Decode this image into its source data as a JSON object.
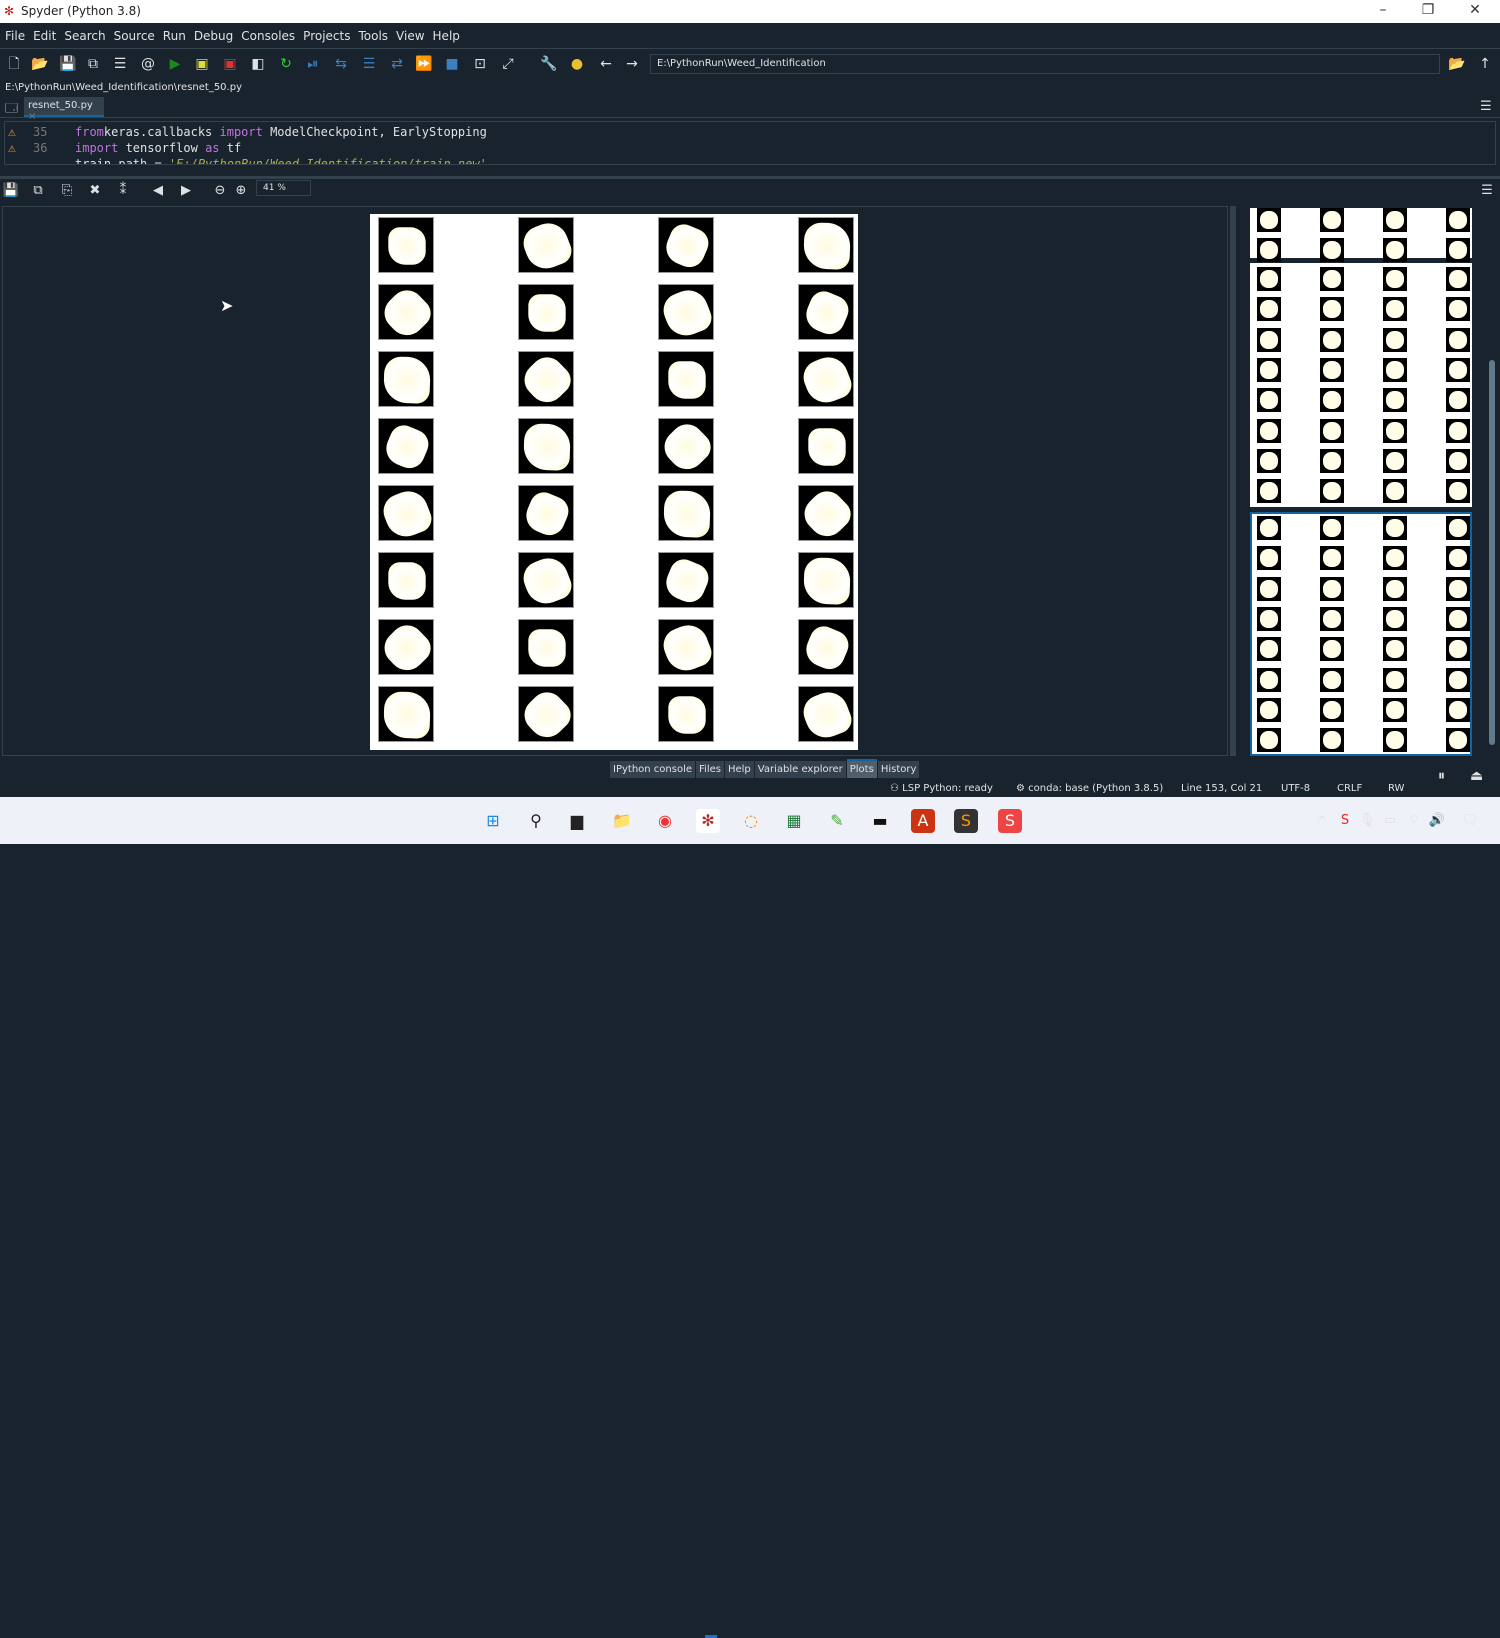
{
  "window": {
    "title": "Spyder (Python 3.8)"
  },
  "menu": [
    "File",
    "Edit",
    "Search",
    "Source",
    "Run",
    "Debug",
    "Consoles",
    "Projects",
    "Tools",
    "View",
    "Help"
  ],
  "toolbar": {
    "working_dir": "E:\\PythonRun\\Weed_Identification"
  },
  "editor": {
    "file_path": "E:\\PythonRun\\Weed_Identification\\resnet_50.py",
    "tab": "resnet_50.py",
    "lines": [
      {
        "no": "35",
        "parts": [
          [
            "kw",
            "from"
          ],
          [
            "",
            "keras.callbacks "
          ],
          [
            "kw",
            "import"
          ],
          [
            "",
            " ModelCheckpoint, EarlyStopping"
          ]
        ]
      },
      {
        "no": "36",
        "parts": [
          [
            "kw",
            "import"
          ],
          [
            "",
            " tensorflow "
          ],
          [
            "kw",
            "as"
          ],
          [
            "",
            " tf"
          ]
        ]
      },
      {
        "no": "",
        "parts": [
          [
            "",
            "train_path = "
          ],
          [
            "st",
            "'E:/PythonRun/Weed_Identification/train_new'"
          ]
        ]
      }
    ]
  },
  "plots": {
    "zoom": "41 %",
    "rows": 8,
    "cols": 4,
    "thumbnails": 3,
    "selected_thumbnail": 3
  },
  "pane_tabs": [
    "IPython console",
    "Files",
    "Help",
    "Variable explorer",
    "Plots",
    "History"
  ],
  "active_pane_tab": "Plots",
  "status": {
    "lsp": "LSP Python: ready",
    "conda": "conda: base (Python 3.8.5)",
    "position": "Line 153, Col 21",
    "encoding": "UTF-8",
    "eol": "CRLF",
    "mode": "RW"
  }
}
